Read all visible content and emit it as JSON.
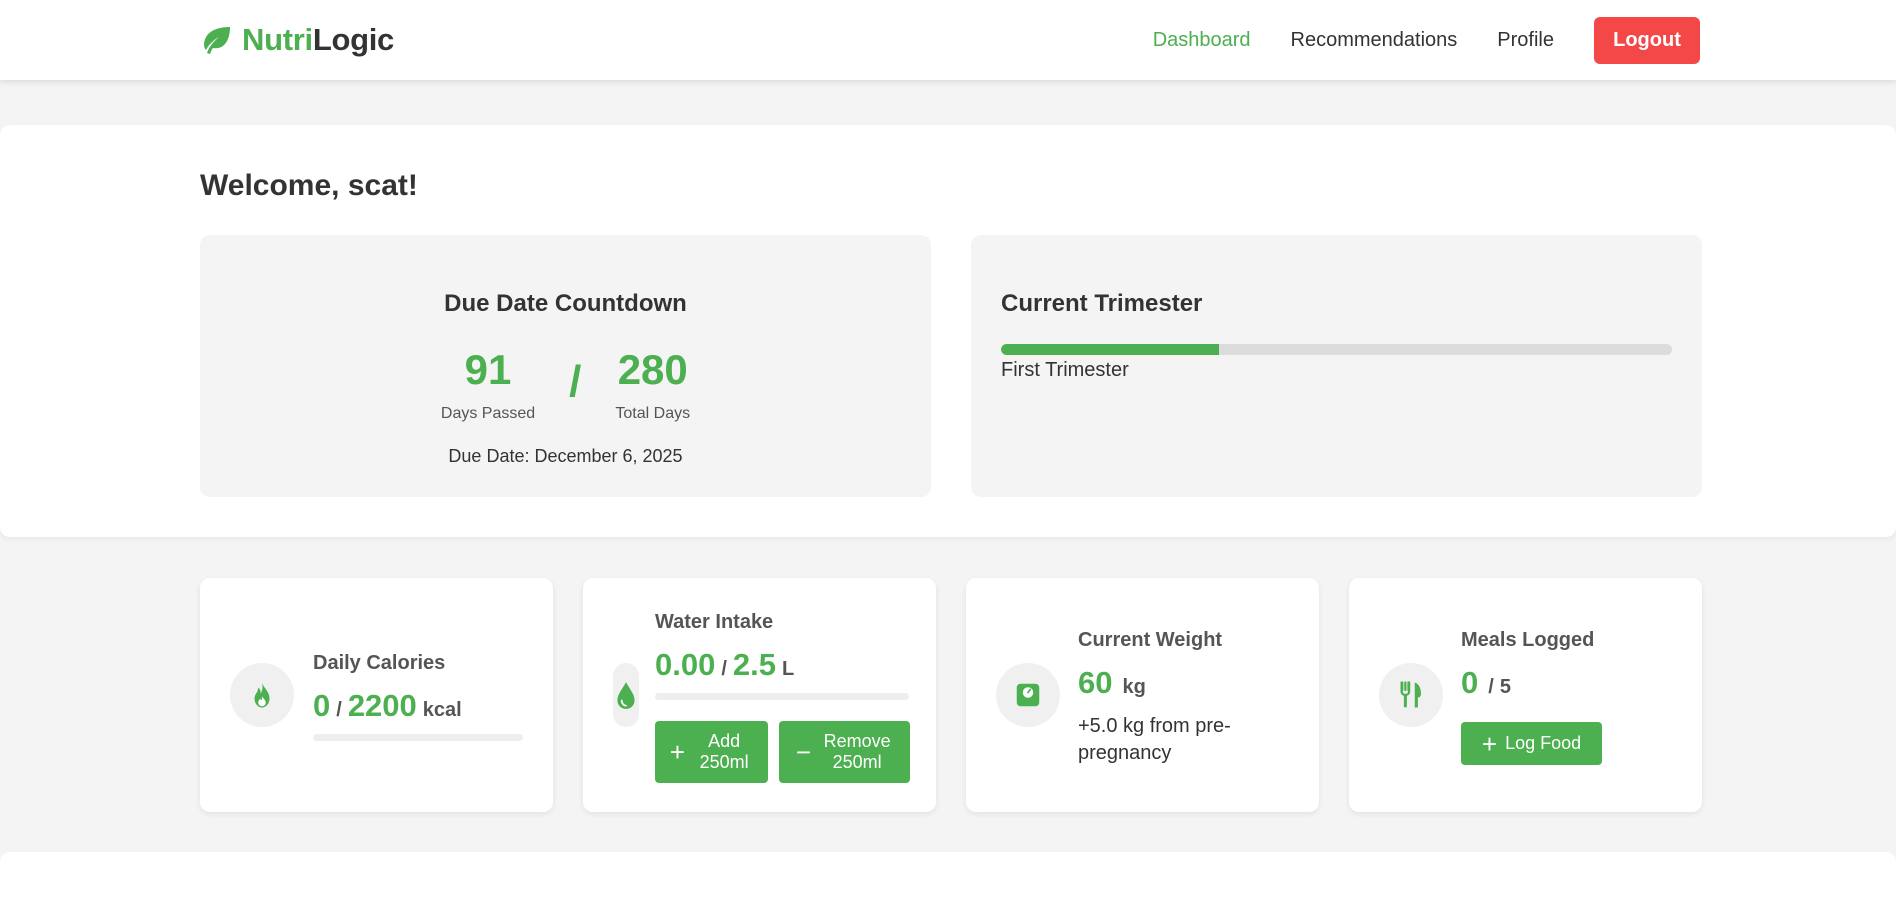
{
  "brand": {
    "name_part1": "Nutri",
    "name_part2": "Logic",
    "icon": "leaf-icon",
    "accent_color": "#4caf50"
  },
  "nav": {
    "links": [
      {
        "label": "Dashboard",
        "active": true
      },
      {
        "label": "Recommendations",
        "active": false
      },
      {
        "label": "Profile",
        "active": false
      }
    ],
    "logout_label": "Logout",
    "logout_color": "#f44747"
  },
  "welcome": {
    "title": "Welcome, scat!"
  },
  "countdown": {
    "title": "Due Date Countdown",
    "days_passed": "91",
    "days_passed_label": "Days Passed",
    "separator": "/",
    "total_days": "280",
    "total_days_label": "Total Days",
    "due_date_text": "Due Date: December 6, 2025"
  },
  "trimester": {
    "title": "Current Trimester",
    "label": "First Trimester",
    "progress_fraction": 0.325
  },
  "stats": {
    "calories": {
      "icon": "flame-icon",
      "label": "Daily Calories",
      "value": "0",
      "sep": "/",
      "target": "2200",
      "unit": "kcal",
      "progress_fraction": 0
    },
    "water": {
      "icon": "water-drop-icon",
      "label": "Water Intake",
      "value": "0.00",
      "sep": "/",
      "target": "2.5",
      "unit": "L",
      "progress_fraction": 0,
      "add_label": "Add 250ml",
      "remove_label": "Remove 250ml",
      "add_icon": "plus-icon",
      "remove_icon": "minus-icon"
    },
    "weight": {
      "icon": "scale-icon",
      "label": "Current Weight",
      "value": "60",
      "unit": "kg",
      "note": "+5.0 kg from pre-pregnancy"
    },
    "meals": {
      "icon": "utensils-icon",
      "label": "Meals Logged",
      "value": "0",
      "sep": "/",
      "target": "5",
      "log_label": "Log Food",
      "log_icon": "plus-icon"
    }
  }
}
